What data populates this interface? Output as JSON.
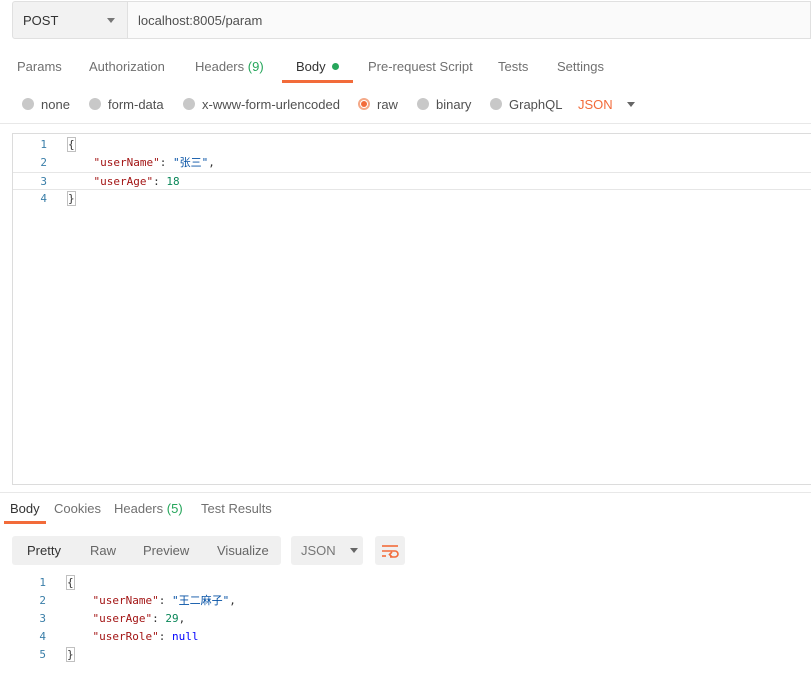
{
  "request": {
    "method": "POST",
    "url": "localhost:8005/param"
  },
  "request_tabs": [
    {
      "label": "Params"
    },
    {
      "label": "Authorization"
    },
    {
      "label": "Headers",
      "count": "(9)"
    },
    {
      "label": "Body"
    },
    {
      "label": "Pre-request Script"
    },
    {
      "label": "Tests"
    },
    {
      "label": "Settings"
    }
  ],
  "body_types": [
    {
      "label": "none"
    },
    {
      "label": "form-data"
    },
    {
      "label": "x-www-form-urlencoded"
    },
    {
      "label": "raw"
    },
    {
      "label": "binary"
    },
    {
      "label": "GraphQL"
    }
  ],
  "body_format": "JSON",
  "request_body": {
    "line_numbers": [
      "1",
      "2",
      "3",
      "4"
    ],
    "open_brace": "{",
    "close_brace": "}",
    "fields": [
      {
        "key": "\"userName\"",
        "value": "\"张三\"",
        "trail": ","
      },
      {
        "key": "\"userAge\"",
        "value": "18",
        "trail": ""
      }
    ]
  },
  "response_tabs": [
    {
      "label": "Body"
    },
    {
      "label": "Cookies"
    },
    {
      "label": "Headers",
      "count": "(5)"
    },
    {
      "label": "Test Results"
    }
  ],
  "response_views": [
    "Pretty",
    "Raw",
    "Preview",
    "Visualize"
  ],
  "response_format": "JSON",
  "response_body": {
    "line_numbers": [
      "1",
      "2",
      "3",
      "4",
      "5"
    ],
    "open_brace": "{",
    "close_brace": "}",
    "fields": [
      {
        "key": "\"userName\"",
        "value": "\"王二麻子\"",
        "trail": ","
      },
      {
        "key": "\"userAge\"",
        "value": "29",
        "trail": ","
      },
      {
        "key": "\"userRole\"",
        "value": "null",
        "trail": ""
      }
    ]
  },
  "colors": {
    "accent": "#f26b3a",
    "count_green": "#26a65b"
  },
  "icons": {
    "method_dropdown": "chevron-down-icon",
    "format_dropdown": "chevron-down-icon",
    "wrap": "wrap-lines-icon",
    "body_dot": "dot-icon"
  }
}
